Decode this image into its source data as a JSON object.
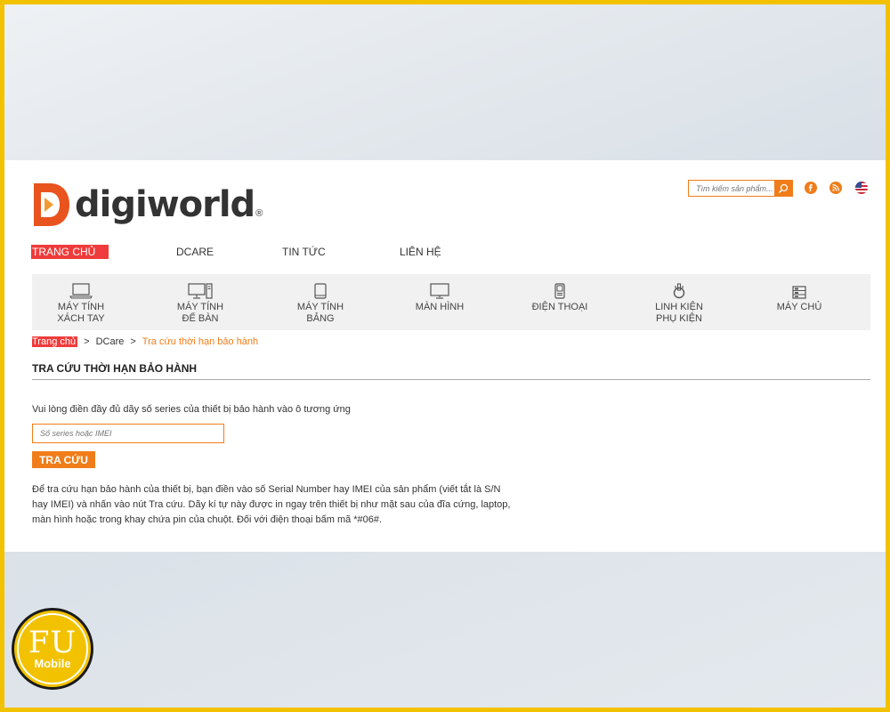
{
  "brand": {
    "logo_text": "digiworld",
    "registered_mark": "®",
    "accent_color": "#f07d1a",
    "highlight_color": "#ef3b3b"
  },
  "header": {
    "search_placeholder": "Tìm kiếm sản phẩm...",
    "search_icon": "search-icon",
    "social_icons": [
      "facebook-icon",
      "rss-icon",
      "us-flag-icon"
    ]
  },
  "nav": {
    "items": [
      {
        "label": "TRANG CHỦ",
        "active": true
      },
      {
        "label": "DCARE"
      },
      {
        "label": "TIN TỨC"
      },
      {
        "label": "LIÊN HỆ"
      }
    ]
  },
  "categories": [
    {
      "line1": "MÁY TÍNH",
      "line2": "XÁCH TAY",
      "icon": "laptop-icon"
    },
    {
      "line1": "MÁY TÍNH",
      "line2": "ĐỂ BÀN",
      "icon": "desktop-icon"
    },
    {
      "line1": "MÁY TÍNH",
      "line2": "BẢNG",
      "icon": "tablet-icon"
    },
    {
      "line1": "MÀN HÌNH",
      "line2": "",
      "icon": "monitor-icon"
    },
    {
      "line1": "ĐIỆN THOẠI",
      "line2": "",
      "icon": "phone-icon"
    },
    {
      "line1": "LINH KIỆN",
      "line2": "PHỤ KIỆN",
      "icon": "accessory-icon"
    },
    {
      "line1": "MÁY CHỦ",
      "line2": "",
      "icon": "server-icon"
    }
  ],
  "breadcrumb": {
    "home": "Trang chủ",
    "separator": ">",
    "parent": "DCare",
    "current": "Tra cứu thời hạn bảo hành"
  },
  "main": {
    "title": "TRA CỨU THỜI HẠN BẢO HÀNH",
    "instruction": "Vui lòng điền đầy đủ dãy số series của thiết bị bảo hành vào ô tương ứng",
    "input_placeholder": "Số series hoặc IMEI",
    "submit_label": "TRA CỨU",
    "description": "Để tra cứu hạn bảo hành của thiết bị, bạn điền vào số Serial Number hay IMEI của sản phẩm (viết tắt là S/N hay IMEI) và nhấn vào nút Tra cứu. Dãy kí tự này được in ngay trên thiết bị như mặt sau của đĩa cứng, laptop, màn hình hoặc trong khay chứa pin của chuột. Đối với điện thoại bấm mã *#06#."
  },
  "badge": {
    "top": "FU",
    "bottom": "Mobile"
  }
}
